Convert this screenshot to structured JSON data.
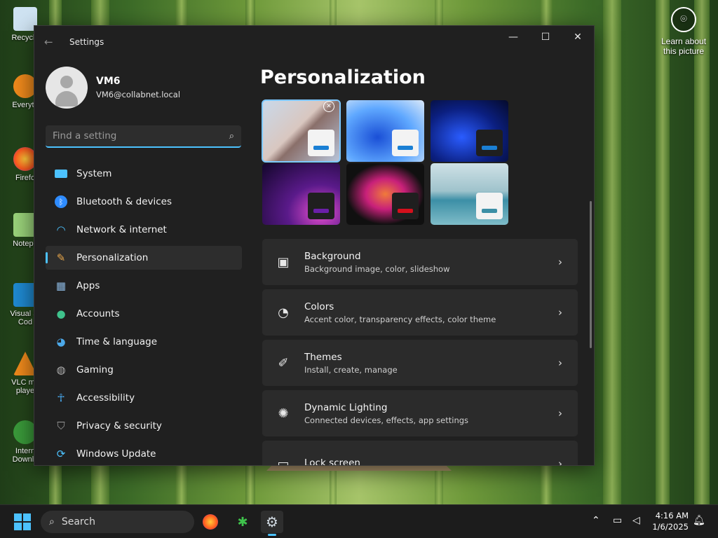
{
  "desktop": {
    "icons": [
      {
        "label": "Recycle",
        "icon": "recycle-bin-icon"
      },
      {
        "label": "Everyth",
        "icon": "everything-search-icon"
      },
      {
        "label": "Firefo",
        "icon": "firefox-icon"
      },
      {
        "label": "Notepa",
        "icon": "notepad-icon"
      },
      {
        "label": "Visual St Cod",
        "icon": "vscode-icon"
      },
      {
        "label": "VLC me playe",
        "icon": "vlc-icon"
      },
      {
        "label": "Intern Downlo",
        "icon": "internet-download-manager-icon"
      }
    ],
    "learn_about": "Learn about this picture"
  },
  "window": {
    "title": "Settings",
    "controls": {
      "minimize": "—",
      "maximize": "☐",
      "close": "✕"
    }
  },
  "profile": {
    "name": "VM6",
    "email": "VM6@collabnet.local"
  },
  "search": {
    "placeholder": "Find a setting"
  },
  "nav": [
    {
      "label": "System",
      "icon": "system-icon",
      "color": "#4cc2ff"
    },
    {
      "label": "Bluetooth & devices",
      "icon": "bluetooth-icon",
      "color": "#2f8cff"
    },
    {
      "label": "Network & internet",
      "icon": "wifi-icon",
      "color": "#4cc2ff"
    },
    {
      "label": "Personalization",
      "icon": "brush-icon",
      "color": "#e8a64a",
      "active": true
    },
    {
      "label": "Apps",
      "icon": "apps-icon",
      "color": "#8bb7e0"
    },
    {
      "label": "Accounts",
      "icon": "accounts-icon",
      "color": "#3fc28c"
    },
    {
      "label": "Time & language",
      "icon": "globe-clock-icon",
      "color": "#4ca8e8"
    },
    {
      "label": "Gaming",
      "icon": "gamepad-icon",
      "color": "#b0b0b0"
    },
    {
      "label": "Accessibility",
      "icon": "accessibility-icon",
      "color": "#4cb4ff"
    },
    {
      "label": "Privacy & security",
      "icon": "shield-icon",
      "color": "#9a9a9a"
    },
    {
      "label": "Windows Update",
      "icon": "update-icon",
      "color": "#4cc2ff"
    }
  ],
  "main": {
    "title": "Personalization",
    "themes": [
      {
        "name": "theme-spring-blossom",
        "accent": "#1a7fd4",
        "selected": true
      },
      {
        "name": "theme-windows-light",
        "accent": "#1a7fd4"
      },
      {
        "name": "theme-windows-dark",
        "accent": "#1a7fd4"
      },
      {
        "name": "theme-glow",
        "accent": "#6a1fa8"
      },
      {
        "name": "theme-captured-motion",
        "accent": "#d4101c"
      },
      {
        "name": "theme-flow",
        "accent": "#3c8fa6"
      }
    ],
    "cards": [
      {
        "title": "Background",
        "subtitle": "Background image, color, slideshow",
        "icon": "image-icon"
      },
      {
        "title": "Colors",
        "subtitle": "Accent color, transparency effects, color theme",
        "icon": "palette-icon"
      },
      {
        "title": "Themes",
        "subtitle": "Install, create, manage",
        "icon": "pen-icon"
      },
      {
        "title": "Dynamic Lighting",
        "subtitle": "Connected devices, effects, app settings",
        "icon": "lighting-icon"
      },
      {
        "title": "Lock screen",
        "subtitle": "",
        "icon": "lock-screen-icon"
      }
    ]
  },
  "taskbar": {
    "search_label": "Search",
    "time": "4:16 AM",
    "date": "1/6/2025"
  },
  "colors": {
    "accent": "#4cc2ff",
    "window_bg": "#202020",
    "card_bg": "#2b2b2b"
  }
}
